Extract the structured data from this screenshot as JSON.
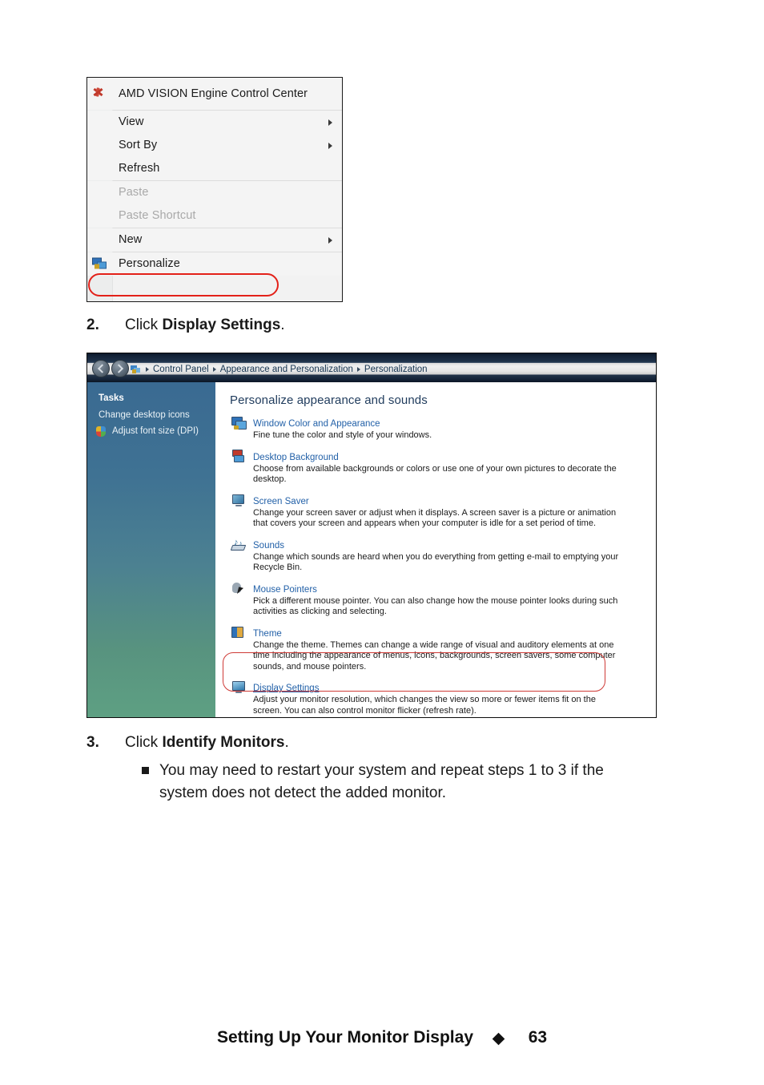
{
  "document": {
    "footer": {
      "title": "Setting Up Your Monitor Display",
      "separator_icon": "diamond-bullet",
      "page_number": "63"
    },
    "steps": [
      {
        "number": "2.",
        "prefix": "Click ",
        "bold": "Display Settings",
        "suffix": "."
      },
      {
        "number": "3.",
        "prefix": "Click ",
        "bold": "Identify Monitors",
        "suffix": "."
      }
    ],
    "note": {
      "bullet_icon": "square-bullet",
      "line1": "You may need to restart your system and repeat steps 1 to 3 if the",
      "line2": "system does not detect the added monitor."
    }
  },
  "context_menu": {
    "highlight_color": "#e32119",
    "items": [
      {
        "label": "AMD VISION Engine Control Center",
        "icon": "amd-vision-icon",
        "has_submenu": false,
        "disabled": false
      },
      {
        "label": "View",
        "icon": "",
        "has_submenu": true,
        "disabled": false
      },
      {
        "label": "Sort By",
        "icon": "",
        "has_submenu": true,
        "disabled": false
      },
      {
        "label": "Refresh",
        "icon": "",
        "has_submenu": false,
        "disabled": false
      },
      {
        "label": "Paste",
        "icon": "",
        "has_submenu": false,
        "disabled": true
      },
      {
        "label": "Paste Shortcut",
        "icon": "",
        "has_submenu": false,
        "disabled": true
      },
      {
        "label": "New",
        "icon": "",
        "has_submenu": true,
        "disabled": false
      },
      {
        "label": "Personalize",
        "icon": "personalize-icon",
        "has_submenu": false,
        "disabled": false
      }
    ]
  },
  "personalization_window": {
    "address_bar": {
      "folder_icon": "control-panel-icon",
      "crumbs": [
        "Control Panel",
        "Appearance and Personalization",
        "Personalization"
      ]
    },
    "sidebar": {
      "title": "Tasks",
      "links": [
        {
          "label": "Change desktop icons",
          "icon": ""
        },
        {
          "label": "Adjust font size (DPI)",
          "icon": "shield-icon"
        }
      ]
    },
    "content": {
      "heading": "Personalize appearance and sounds",
      "highlight_color": "#cf3b37",
      "items": [
        {
          "icon": "window-color-icon",
          "title": "Window Color and Appearance",
          "desc": "Fine tune the color and style of your windows.",
          "highlighted": false
        },
        {
          "icon": "desktop-background-icon",
          "title": "Desktop Background",
          "desc": "Choose from available backgrounds or colors or use one of your own pictures to decorate the desktop.",
          "highlighted": false
        },
        {
          "icon": "screen-saver-icon",
          "title": "Screen Saver",
          "desc": "Change your screen saver or adjust when it displays. A screen saver is a picture or animation that covers your screen and appears when your computer is idle for a set period of time.",
          "highlighted": false
        },
        {
          "icon": "sounds-icon",
          "title": "Sounds",
          "desc": "Change which sounds are heard when you do everything from getting e-mail to emptying your Recycle Bin.",
          "highlighted": false
        },
        {
          "icon": "mouse-pointers-icon",
          "title": "Mouse Pointers",
          "desc": "Pick a different mouse pointer. You can also change how the mouse pointer looks during such activities as clicking and selecting.",
          "highlighted": false
        },
        {
          "icon": "theme-icon",
          "title": "Theme",
          "desc": "Change the theme. Themes can change a wide range of visual and auditory elements at one time including the appearance of menus, icons, backgrounds, screen savers, some computer sounds, and mouse pointers.",
          "highlighted": false
        },
        {
          "icon": "display-settings-icon",
          "title": "Display Settings",
          "desc": "Adjust your monitor resolution, which changes the view so more or fewer items fit on the screen. You can also control monitor flicker (refresh rate).",
          "highlighted": true
        }
      ]
    }
  }
}
